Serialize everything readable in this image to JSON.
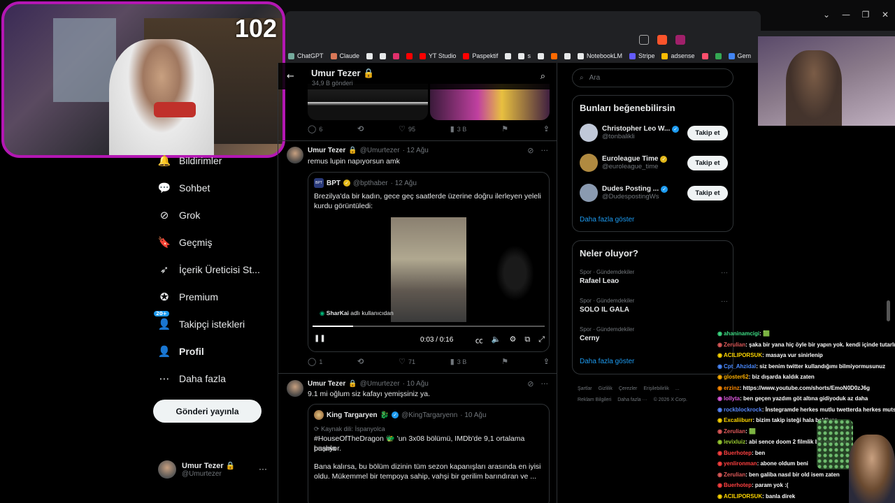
{
  "stream": {
    "counter": "102"
  },
  "bookmarks": [
    {
      "label": "ChatGPT",
      "color": "#74aa9c"
    },
    {
      "label": "Claude",
      "color": "#d97757"
    },
    {
      "label": "",
      "color": "#e7e9ea"
    },
    {
      "label": "",
      "color": "#e7e9ea"
    },
    {
      "label": "",
      "color": "#e1306c"
    },
    {
      "label": "",
      "color": "#ff0000"
    },
    {
      "label": "YT Studio",
      "color": "#ff0000"
    },
    {
      "label": "Paspektif",
      "color": "#ff0000"
    },
    {
      "label": "",
      "color": "#e7e9ea"
    },
    {
      "label": "s",
      "color": "#e7e9ea"
    },
    {
      "label": "",
      "color": "#e7e9ea"
    },
    {
      "label": "",
      "color": "#ff6a00"
    },
    {
      "label": "",
      "color": "#e7e9ea"
    },
    {
      "label": "NotebookLM",
      "color": "#e7e9ea"
    },
    {
      "label": "Stripe",
      "color": "#635bff"
    },
    {
      "label": "adsense",
      "color": "#fbbc04"
    },
    {
      "label": "",
      "color": "#ff4f6d"
    },
    {
      "label": "",
      "color": "#34a853"
    },
    {
      "label": "Gem",
      "color": "#4285f4"
    }
  ],
  "nav": {
    "items": [
      {
        "label": "Bildirimler",
        "icon": "bell-icon",
        "glyph": "🔔"
      },
      {
        "label": "Sohbet",
        "icon": "chat-icon",
        "glyph": "💬"
      },
      {
        "label": "Grok",
        "icon": "grok-icon",
        "glyph": "⊘"
      },
      {
        "label": "Geçmiş",
        "icon": "bookmark-icon",
        "glyph": "🔖"
      },
      {
        "label": "İçerik Üreticisi St...",
        "icon": "rocket-icon",
        "glyph": "➶"
      },
      {
        "label": "Premium",
        "icon": "premium-icon",
        "glyph": "✪"
      },
      {
        "label": "Takipçi istekleri",
        "icon": "follower-requests-icon",
        "glyph": "👤",
        "badge": "20+"
      },
      {
        "label": "Profil",
        "icon": "profile-icon",
        "glyph": "👤"
      },
      {
        "label": "Daha fazla",
        "icon": "more-circle-icon",
        "glyph": "⋯"
      }
    ],
    "post_button": "Gönderi yayınla"
  },
  "account": {
    "name": "Umur Tezer",
    "handle": "@Umurtezer"
  },
  "header": {
    "title": "Umur Tezer",
    "subtitle": "34,9 B gönderi"
  },
  "tweet0_actions": {
    "replies": "6",
    "likes": "95",
    "views": "3 B"
  },
  "tweet1": {
    "name": "Umur Tezer",
    "handle": "@Umurtezer",
    "date": "· 12 Ağu",
    "text": "remus lupin napıyorsun amk",
    "quote": {
      "name": "BPT",
      "handle": "@bpthaber",
      "date": "· 12 Ağu",
      "avatar_text": "BPT",
      "text": "Brezilya'da bir kadın, gece geç saatlerde üzerine doğru ilerleyen yeleli kurdu görüntüledi:",
      "credit_user": "SharKai",
      "credit_suffix": "adlı kullanıcıdan",
      "time": "0:03 / 0:16"
    },
    "actions": {
      "replies": "1",
      "likes": "71",
      "views": "3 B"
    }
  },
  "tweet2": {
    "name": "Umur Tezer",
    "handle": "@Umurtezer",
    "date": "· 10 Ağu",
    "text": "9.1 mi oğlum siz kafayı yemişsiniz ya.",
    "quote": {
      "name": "King Targaryen",
      "handle": "@KingTargaryenn",
      "date": "· 10 Ağu",
      "source": "Kaynak dili: İspanyolca",
      "line1": "#HouseOfTheDragon 🐲 'un 3x08 bölümü, IMDb'de 9,1 ortalama puanla",
      "line2": "başlıyor.",
      "line3": "Bana kalırsa, bu bölüm dizinin tüm sezon kapanışları arasında en iyisi",
      "line4": "oldu. Mükemmel bir tempoya sahip, vahşi bir gerilim barındıran ve ..."
    }
  },
  "search": {
    "placeholder": "Ara"
  },
  "suggestions": {
    "title": "Bunları beğenebilirsin",
    "follow_label": "Takip et",
    "people": [
      {
        "name": "Christopher Leo W...",
        "handle": "@tonbalikli",
        "color": "#c0c8d8"
      },
      {
        "name": "Euroleague Time",
        "handle": "@euroleague_time",
        "color": "#b08a40"
      },
      {
        "name": "Dudes Posting ...",
        "handle": "@DudespostingWs",
        "color": "#8a9ab0"
      }
    ],
    "more": "Daha fazla göster"
  },
  "trends": {
    "title": "Neler oluyor?",
    "items": [
      {
        "category": "Spor · Gündemdekiler",
        "name": "Rafael Leao"
      },
      {
        "category": "Spor · Gündemdekiler",
        "name": "SOLO IL GALA"
      },
      {
        "category": "Spor · Gündemdekiler",
        "name": "Cerny"
      }
    ],
    "more": "Daha fazla göster"
  },
  "footer": {
    "line1": [
      "Şartlar",
      "Gizlilik",
      "Çerezler",
      "Erişilebilirlik",
      "..."
    ],
    "line2": [
      "Reklam Bilgileri",
      "Daha fazla ···",
      "© 2026 X Corp."
    ]
  },
  "chat": [
    {
      "user": "ahaninamcigi",
      "color": "#3ddc84",
      "text": ": 🟩"
    },
    {
      "user": "Zerulian",
      "color": "#e05a5a",
      "text": ": şaka bir yana hiç öyle bir yapın yok. kendi içinde tutarlı"
    },
    {
      "user": "ACILIPORSUK",
      "color": "#ffd700",
      "text": ": masaya vur sinirlenip"
    },
    {
      "user": "Cpt_Ahzidal",
      "color": "#4a8aff",
      "text": ": siz benim twitter kullandığımı bilmiyormusunuz"
    },
    {
      "user": "gloster62",
      "color": "#ffb000",
      "text": ": biz dışarda kaldık zaten"
    },
    {
      "user": "erzinz",
      "color": "#ff8a00",
      "text": ": https://www.youtube.com/shorts/EmoN0D0zJ6g"
    },
    {
      "user": "lollyta",
      "color": "#e05ae0",
      "text": ": ben geçen yazdım göt altına gidiyoduk az daha"
    },
    {
      "user": "rockblockrock",
      "color": "#5a8aff",
      "text": ": İnstegramde herkes mutlu twetterda herkes mutsuz"
    },
    {
      "user": "Excaliiburr",
      "color": "#ffd700",
      "text": ": bizim takip isteği hala bekliyor"
    },
    {
      "user": "Zerulian",
      "color": "#e05a5a",
      "text": ": 🟩"
    },
    {
      "user": "levixluiz",
      "color": "#9acd32",
      "text": ": abi sence doom 2 filmlik bir oyun mu"
    },
    {
      "user": "Buerhotep",
      "color": "#ff4040",
      "text": ": ben"
    },
    {
      "user": "yenlironman",
      "color": "#ff4040",
      "text": ": abone oldum beni"
    },
    {
      "user": "Zerulian",
      "color": "#e05a5a",
      "text": ": ben galiba nasıl bir old isem zaten"
    },
    {
      "user": "Buerhotep",
      "color": "#ff4040",
      "text": ": param yok :("
    },
    {
      "user": "ACILIPORSUK",
      "color": "#ffd700",
      "text": ": banla direk"
    }
  ]
}
